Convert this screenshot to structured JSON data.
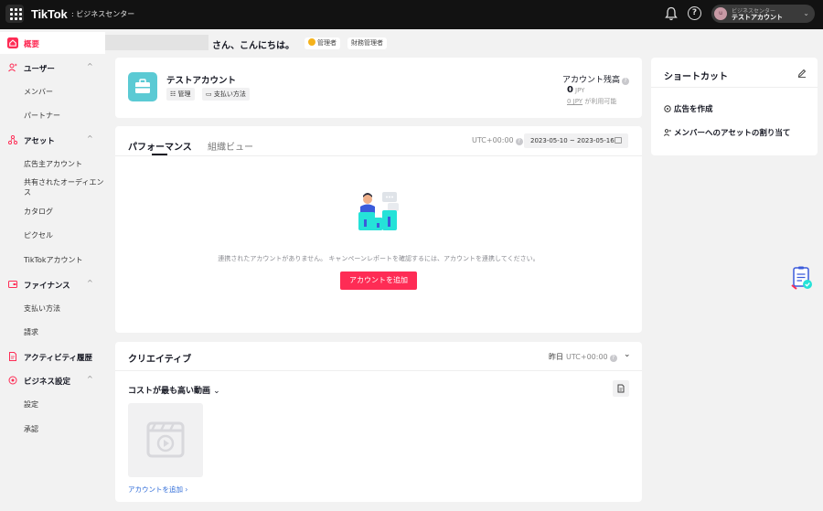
{
  "header": {
    "logo": "TikTok",
    "logo_sub": ": ビジネスセンター",
    "account_sub": "ビジネスセンター",
    "account_name": "テストアカウント",
    "avatar_letter": "u"
  },
  "sidebar": {
    "overview": "概要",
    "users": "ユーザー",
    "users_items": [
      "メンバー",
      "パートナー"
    ],
    "assets": "アセット",
    "assets_items": [
      "広告主アカウント",
      "共有されたオーディエン",
      "ス",
      "カタログ",
      "ピクセル",
      "TikTokアカウント"
    ],
    "finance": "ファイナンス",
    "finance_items": [
      "支払い方法",
      "請求"
    ],
    "activity": "アクティビティ履歴",
    "business": "ビジネス設定",
    "business_items": [
      "設定",
      "承認"
    ]
  },
  "greeting": {
    "text": "さん、こんにちは。",
    "role_admin": "管理者",
    "role_finance": "財務管理者"
  },
  "account_card": {
    "title": "テストアカウント",
    "manage": "管理",
    "payment": "支払い方法",
    "balance_label": "アカウント残高",
    "balance_value": "0",
    "balance_currency": "JPY",
    "available_amount": "0 JPY",
    "available_suffix": " が利用可能"
  },
  "performance": {
    "tab_active": "パフォーマンス",
    "tab_inactive": "組織ビュー",
    "timezone": "UTC+00:00",
    "date_range": "2023-05-10 ~ 2023-05-16",
    "empty_message": "連携されたアカウントがありません。 キャンペーンレポートを確認するには、アカウントを連携してください。",
    "add_account": "アカウントを追加"
  },
  "creative": {
    "title": "クリエイティブ",
    "period": "昨日",
    "timezone": "UTC+00:00",
    "subtitle": "コストが最も高い動画",
    "link": "アカウントを追加 ›"
  },
  "shortcuts": {
    "title": "ショートカット",
    "items": [
      "広告を作成",
      "メンバーへのアセットの割り当て"
    ]
  },
  "colors": {
    "accent": "#fe2c55",
    "topbar": "#121212",
    "icon_teal": "#5bcad4",
    "link": "#2e6bd8"
  }
}
